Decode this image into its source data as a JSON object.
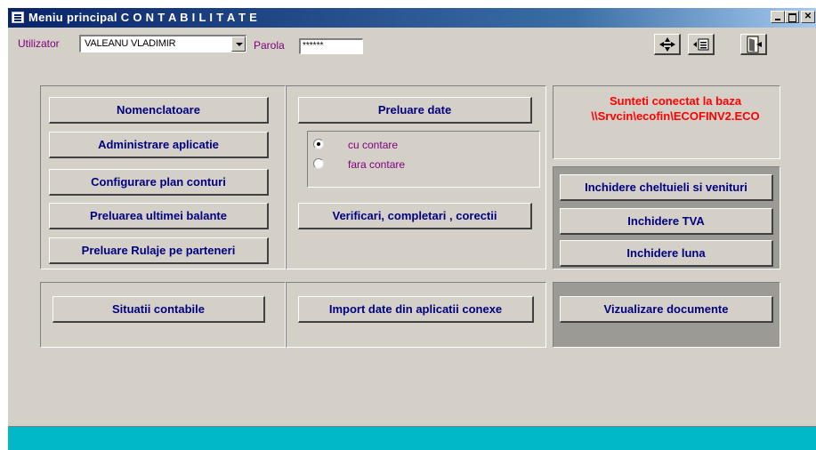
{
  "window": {
    "title": "Meniu principal C O N T A B I L I T A T E",
    "controls": [
      "minimize",
      "maximize",
      "close"
    ]
  },
  "toolbar": {
    "user_label": "Utilizator",
    "user_value": "VALEANU VLADIMIR",
    "password_label": "Parola",
    "password_value": "******",
    "icons": [
      "navigate-icon",
      "form-icon",
      "exit-icon"
    ]
  },
  "panel_left": {
    "buttons": [
      "Nomenclatoare",
      "Administrare aplicatie",
      "Configurare plan conturi",
      "Preluarea ultimei balante",
      "Preluare Rulaje pe parteneri"
    ]
  },
  "panel_middle": {
    "preluare_label": "Preluare date",
    "options": [
      {
        "label": "cu contare",
        "selected": true
      },
      {
        "label": "fara contare",
        "selected": false
      }
    ],
    "verificari_label": "Verificari, completari , corectii"
  },
  "connection": {
    "line1": "Sunteti conectat la baza",
    "line2": "\\\\Srvcin\\ecofin\\ECOFINV2.ECO"
  },
  "panel_close": {
    "buttons": [
      "Inchidere cheltuieli si venituri",
      "Inchidere TVA",
      "Inchidere luna"
    ]
  },
  "bottom": {
    "situatii_label": "Situatii contabile",
    "import_label": "Import date din aplicatii conexe",
    "vizualizare_label": "Vizualizare documente"
  },
  "colors": {
    "title_bar": "#0a246a",
    "button_text": "#000080",
    "connection_text": "#ff0000",
    "label_text": "#800080",
    "status_bar": "#00b8c8",
    "face": "#d4d0c8"
  }
}
